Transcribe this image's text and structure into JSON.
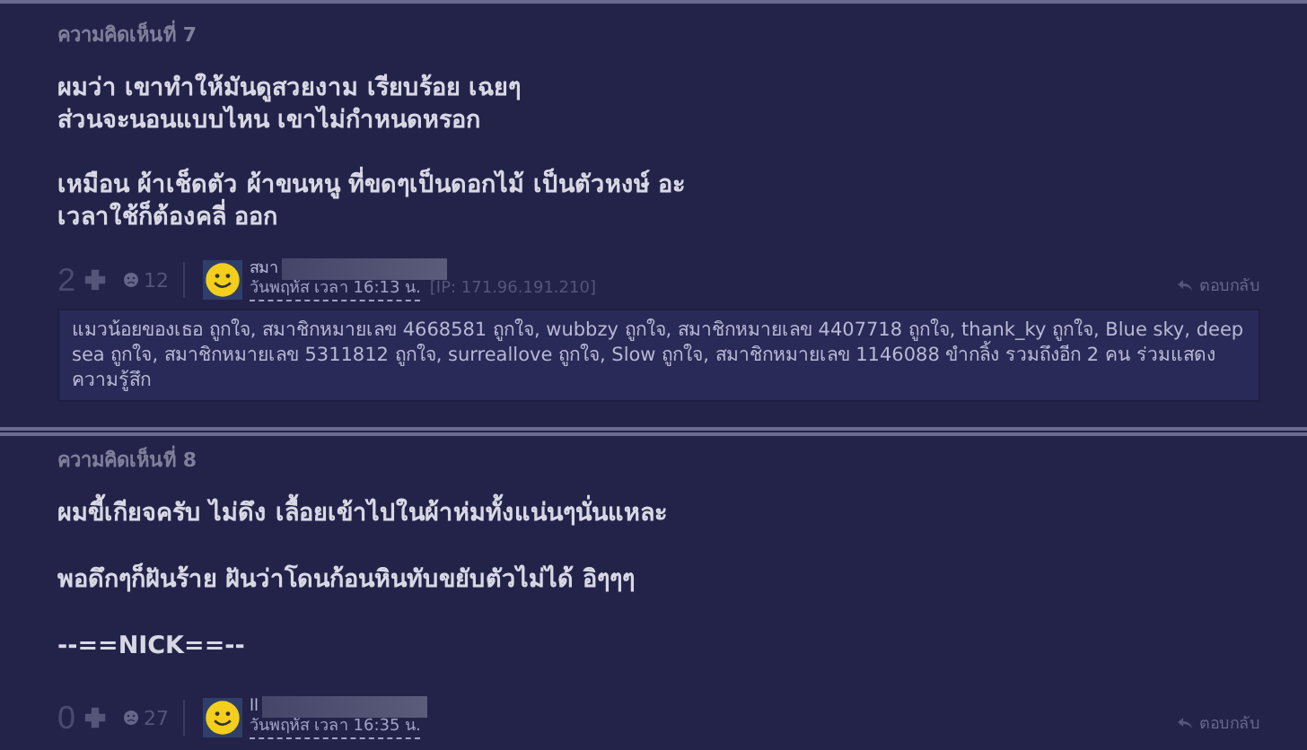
{
  "comments": [
    {
      "header": "ความคิดเห็นที่ 7",
      "paragraphs": [
        "ผมว่า เขาทำให้มันดูสวยงาม เรียบร้อย เฉยๆ\nส่วนจะนอนแบบไหน เขาไม่กำหนดหรอก",
        "เหมือน ผ้าเช็ดตัว ผ้าขนหนู ที่ขดๆเป็นดอกไม้ เป็นตัวหงษ์ อะ\nเวลาใช้ก็ต้องคลี่ ออก"
      ],
      "votes": "2",
      "emotions": "12",
      "user": "สมา",
      "date": "วันพฤหัส เวลา 16:13 น.",
      "ip": "[IP: 171.96.191.210]",
      "reply": "ตอบกลับ",
      "likes": "แมวน้อยของเธอ ถูกใจ, สมาชิกหมายเลข 4668581 ถูกใจ, wubbzy ถูกใจ, สมาชิกหมายเลข 4407718 ถูกใจ, thank_ky ถูกใจ, Blue sky, deep sea ถูกใจ, สมาชิกหมายเลข 5311812 ถูกใจ, surreallove ถูกใจ, Slow ถูกใจ, สมาชิกหมายเลข 1146088 ขำกลิ้ง รวมถึงอีก 2 คน ร่วมแสดงความรู้สึก"
    },
    {
      "header": "ความคิดเห็นที่ 8",
      "paragraphs": [
        "ผมขี้เกียจครับ ไม่ดึง เลื้อยเข้าไปในผ้าห่มทั้งแน่นๆนั่นแหละ",
        "พอดึกๆก็ฝันร้าย ฝันว่าโดนก้อนหินทับขยับตัวไม่ได้ อิๆๆๆ",
        "--==NICK==--"
      ],
      "votes": "0",
      "emotions": "27",
      "user": "ll",
      "date": "วันพฤหัส เวลา 16:35 น.",
      "reply": "ตอบกลับ"
    }
  ]
}
